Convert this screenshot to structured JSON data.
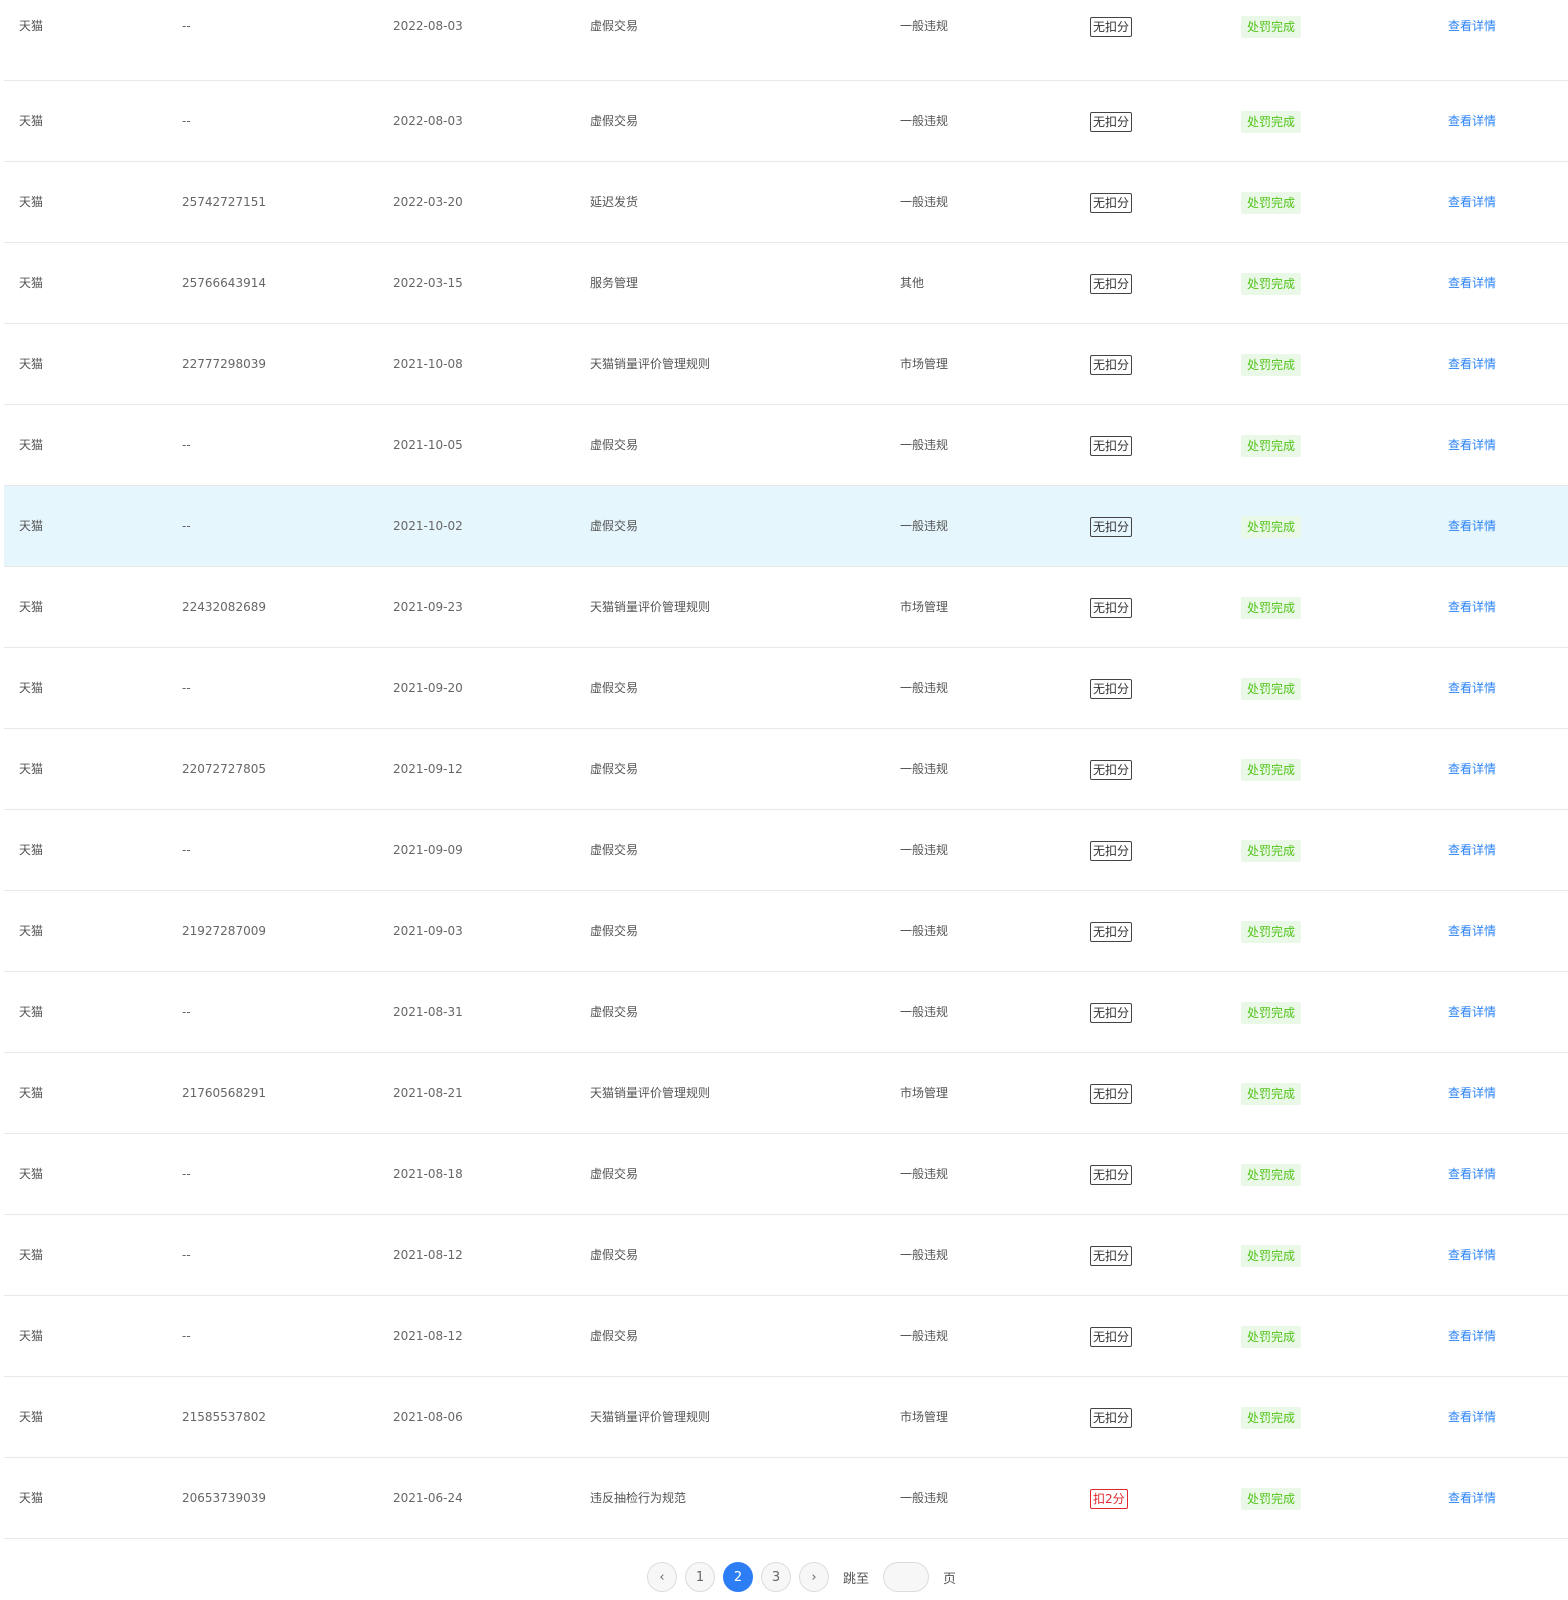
{
  "rows": [
    {
      "platform": "天猫",
      "order": "--",
      "date": "2022-08-03",
      "type": "虚假交易",
      "level": "一般违规",
      "score": "无扣分",
      "status": "处罚完成",
      "action": "查看详情"
    },
    {
      "platform": "天猫",
      "order": "--",
      "date": "2022-08-03",
      "type": "虚假交易",
      "level": "一般违规",
      "score": "无扣分",
      "status": "处罚完成",
      "action": "查看详情"
    },
    {
      "platform": "天猫",
      "order": "25742727151",
      "date": "2022-03-20",
      "type": "延迟发货",
      "level": "一般违规",
      "score": "无扣分",
      "status": "处罚完成",
      "action": "查看详情"
    },
    {
      "platform": "天猫",
      "order": "25766643914",
      "date": "2022-03-15",
      "type": "服务管理",
      "level": "其他",
      "score": "无扣分",
      "status": "处罚完成",
      "action": "查看详情"
    },
    {
      "platform": "天猫",
      "order": "22777298039",
      "date": "2021-10-08",
      "type": "天猫销量评价管理规则",
      "level": "市场管理",
      "score": "无扣分",
      "status": "处罚完成",
      "action": "查看详情"
    },
    {
      "platform": "天猫",
      "order": "--",
      "date": "2021-10-05",
      "type": "虚假交易",
      "level": "一般违规",
      "score": "无扣分",
      "status": "处罚完成",
      "action": "查看详情"
    },
    {
      "platform": "天猫",
      "order": "--",
      "date": "2021-10-02",
      "type": "虚假交易",
      "level": "一般违规",
      "score": "无扣分",
      "status": "处罚完成",
      "action": "查看详情"
    },
    {
      "platform": "天猫",
      "order": "22432082689",
      "date": "2021-09-23",
      "type": "天猫销量评价管理规则",
      "level": "市场管理",
      "score": "无扣分",
      "status": "处罚完成",
      "action": "查看详情"
    },
    {
      "platform": "天猫",
      "order": "--",
      "date": "2021-09-20",
      "type": "虚假交易",
      "level": "一般违规",
      "score": "无扣分",
      "status": "处罚完成",
      "action": "查看详情"
    },
    {
      "platform": "天猫",
      "order": "22072727805",
      "date": "2021-09-12",
      "type": "虚假交易",
      "level": "一般违规",
      "score": "无扣分",
      "status": "处罚完成",
      "action": "查看详情"
    },
    {
      "platform": "天猫",
      "order": "--",
      "date": "2021-09-09",
      "type": "虚假交易",
      "level": "一般违规",
      "score": "无扣分",
      "status": "处罚完成",
      "action": "查看详情"
    },
    {
      "platform": "天猫",
      "order": "21927287009",
      "date": "2021-09-03",
      "type": "虚假交易",
      "level": "一般违规",
      "score": "无扣分",
      "status": "处罚完成",
      "action": "查看详情"
    },
    {
      "platform": "天猫",
      "order": "--",
      "date": "2021-08-31",
      "type": "虚假交易",
      "level": "一般违规",
      "score": "无扣分",
      "status": "处罚完成",
      "action": "查看详情"
    },
    {
      "platform": "天猫",
      "order": "21760568291",
      "date": "2021-08-21",
      "type": "天猫销量评价管理规则",
      "level": "市场管理",
      "score": "无扣分",
      "status": "处罚完成",
      "action": "查看详情"
    },
    {
      "platform": "天猫",
      "order": "--",
      "date": "2021-08-18",
      "type": "虚假交易",
      "level": "一般违规",
      "score": "无扣分",
      "status": "处罚完成",
      "action": "查看详情"
    },
    {
      "platform": "天猫",
      "order": "--",
      "date": "2021-08-12",
      "type": "虚假交易",
      "level": "一般违规",
      "score": "无扣分",
      "status": "处罚完成",
      "action": "查看详情"
    },
    {
      "platform": "天猫",
      "order": "--",
      "date": "2021-08-12",
      "type": "虚假交易",
      "level": "一般违规",
      "score": "无扣分",
      "status": "处罚完成",
      "action": "查看详情"
    },
    {
      "platform": "天猫",
      "order": "21585537802",
      "date": "2021-08-06",
      "type": "天猫销量评价管理规则",
      "level": "市场管理",
      "score": "无扣分",
      "status": "处罚完成",
      "action": "查看详情"
    },
    {
      "platform": "天猫",
      "order": "20653739039",
      "date": "2021-06-24",
      "type": "违反抽检行为规范",
      "level": "一般违规",
      "score": "扣2分",
      "status": "处罚完成",
      "action": "查看详情"
    }
  ],
  "highlight_row": 6,
  "pagination": {
    "prev_icon": "chevron-left-icon",
    "next_icon": "chevron-right-icon",
    "prev_glyph": "‹",
    "next_glyph": "›",
    "pages": [
      "1",
      "2",
      "3"
    ],
    "current": "2",
    "goto_label": "跳至",
    "page_suffix": "页",
    "goto_value": ""
  },
  "colors": {
    "accent": "#2d7df5",
    "link": "#2d84f5",
    "status_green": "#52c41a",
    "penalty_red": "#e0282e",
    "highlight": "#e6f6fd"
  }
}
